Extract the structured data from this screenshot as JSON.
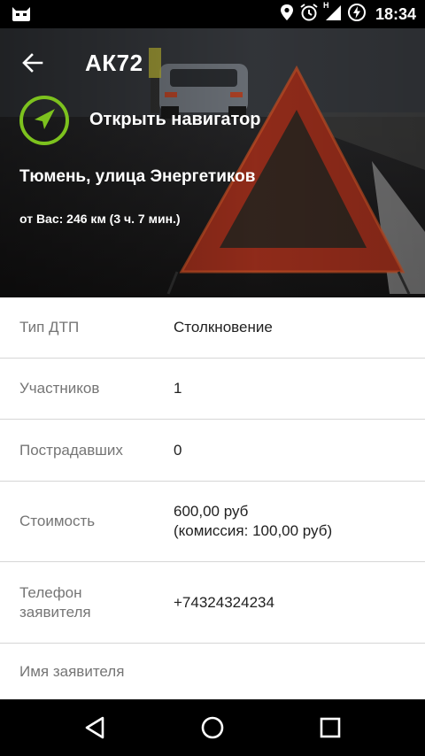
{
  "status_bar": {
    "time": "18:34",
    "network_letter": "H",
    "icons": [
      "app-notification-icon",
      "location-icon",
      "alarm-icon",
      "signal-icon",
      "battery-charging-icon"
    ]
  },
  "header": {
    "title": "АК72",
    "open_navigator_label": "Открыть навигатор",
    "address": "Тюмень, улица Энергетиков",
    "distance": "от Вас: 246 км (3 ч. 7 мин.)",
    "accent_color": "#7dc21e"
  },
  "details": [
    {
      "label": "Тип ДТП",
      "value": "Столкновение"
    },
    {
      "label": "Участников",
      "value": "1"
    },
    {
      "label": "Пострадавших",
      "value": "0"
    },
    {
      "label": "Стоимость",
      "value_line1": "600,00 руб",
      "value_line2": "(комиссия: 100,00 руб)"
    },
    {
      "label_line1": "Телефон",
      "label_line2": "заявителя",
      "value": "+74324324234"
    },
    {
      "label": "Имя заявителя",
      "value": ""
    }
  ],
  "nav_bar": {
    "icons": [
      "back-triangle-icon",
      "home-circle-icon",
      "recents-square-icon"
    ]
  }
}
